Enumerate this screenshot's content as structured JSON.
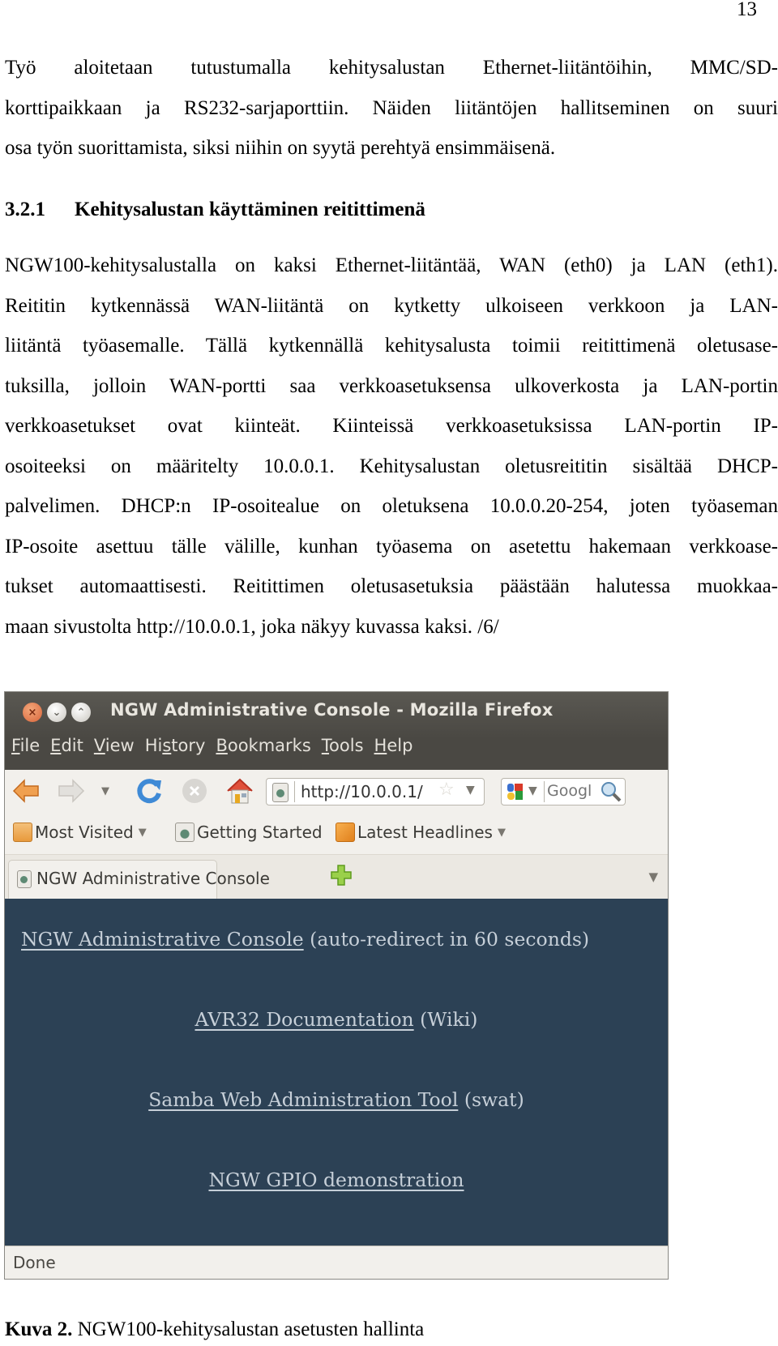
{
  "page_number": "13",
  "intro_paragraph": {
    "lines": [
      "Työ aloitetaan tutustumalla kehitysalustan Ethernet-liitäntöihin, MMC/SD-",
      "korttipaikkaan ja RS232-sarjaporttiin. Näiden liitäntöjen hallitseminen on suuri",
      "osa työn suorittamista, siksi niihin on syytä perehtyä ensimmäisenä."
    ]
  },
  "section_heading": {
    "number": "3.2.1",
    "title": "Kehitysalustan käyttäminen reitittimenä"
  },
  "body_paragraph": {
    "lines": [
      "NGW100-kehitysalustalla on kaksi Ethernet-liitäntää, WAN (eth0) ja LAN (eth1).",
      "Reititin kytkennässä WAN-liitäntä on kytketty ulkoiseen verkkoon ja LAN-",
      "liitäntä työasemalle. Tällä kytkennällä kehitysalusta toimii reitittimenä oletusase-",
      "tuksilla, jolloin WAN-portti saa verkkoasetuksensa ulkoverkosta ja LAN-portin",
      "verkkoasetukset ovat kiinteät. Kiinteissä verkkoasetuksissa LAN-portin IP-",
      "osoiteeksi on määritelty 10.0.0.1. Kehitysalustan oletusreititin sisältää DHCP-",
      "palvelimen. DHCP:n IP-osoitealue on oletuksena 10.0.0.20-254, joten työaseman",
      "IP-osoite asettuu tälle välille, kunhan työasema on asetettu hakemaan verkkoase-",
      "tukset automaattisesti. Reitittimen oletusasetuksia päästään halutessa muokkaa-",
      "maan sivustolta http://10.0.0.1, joka näkyy kuvassa kaksi. /6/"
    ]
  },
  "browser": {
    "window_title": "NGW Administrative Console - Mozilla Firefox",
    "window_buttons": [
      "close",
      "minimize",
      "maximize"
    ],
    "menu": [
      {
        "mnemonic": "F",
        "rest": "ile"
      },
      {
        "mnemonic": "E",
        "rest": "dit"
      },
      {
        "mnemonic": "V",
        "rest": "iew"
      },
      {
        "pre": "Hi",
        "mnemonic": "s",
        "rest": "tory"
      },
      {
        "mnemonic": "B",
        "rest": "ookmarks"
      },
      {
        "mnemonic": "T",
        "rest": "ools"
      },
      {
        "mnemonic": "H",
        "rest": "elp"
      }
    ],
    "url": "http://10.0.0.1/",
    "search_placeholder": "Googl",
    "bookmarks": [
      {
        "label": "Most Visited",
        "icon": "folder-icon",
        "dropdown": true
      },
      {
        "label": "Getting Started",
        "icon": "page-icon",
        "dropdown": false
      },
      {
        "label": "Latest Headlines",
        "icon": "rss-icon",
        "dropdown": true
      }
    ],
    "active_tab": "NGW Administrative Console",
    "content": {
      "links": [
        {
          "link": "NGW Administrative Console",
          "suffix": " (auto-redirect in 60 seconds)"
        },
        {
          "link": "AVR32 Documentation",
          "suffix": " (Wiki)"
        },
        {
          "link": "Samba Web Administration Tool",
          "suffix": " (swat)"
        },
        {
          "link": "NGW GPIO demonstration",
          "suffix": ""
        }
      ],
      "background_color": "#2c4155",
      "text_color": "#c6cfd8"
    },
    "status": "Done"
  },
  "caption": {
    "label": "Kuva 2.",
    "text": " NGW100-kehitysalustan asetusten hallinta"
  }
}
